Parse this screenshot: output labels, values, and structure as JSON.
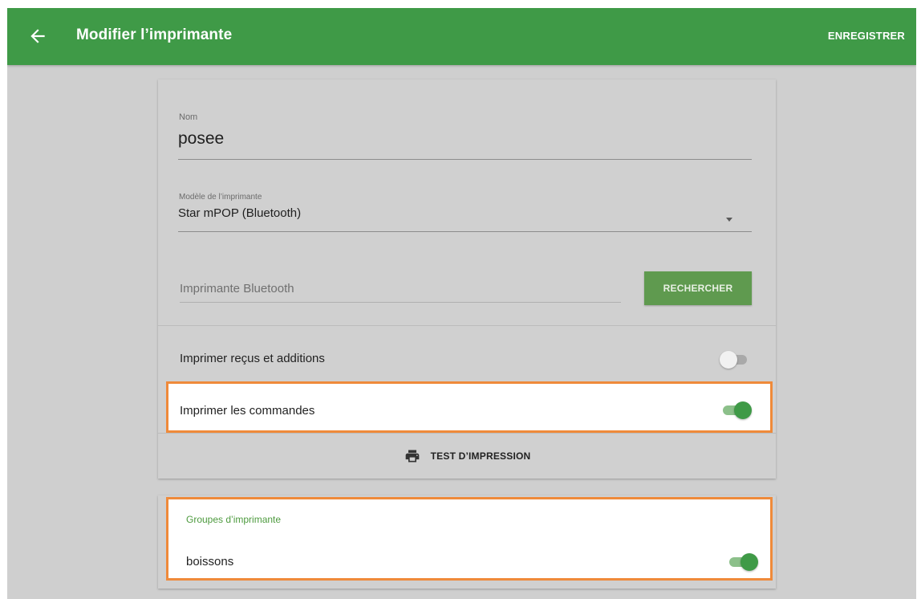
{
  "appbar": {
    "title": "Modifier l’imprimante",
    "save_label": "ENREGISTRER",
    "color": "#3f9a47"
  },
  "form": {
    "name": {
      "label": "Nom",
      "value": "posee"
    },
    "model": {
      "label": "Modèle de l’imprimante",
      "value": "Star mPOP (Bluetooth)"
    },
    "bluetooth": {
      "placeholder": "Imprimante Bluetooth",
      "search_label": "RECHERCHER"
    }
  },
  "toggles": {
    "receipts": {
      "label": "Imprimer reçus et additions",
      "on": false
    },
    "orders": {
      "label": "Imprimer les commandes",
      "on": true
    }
  },
  "test_print": {
    "label": "TEST D’IMPRESSION",
    "icon": "printer-icon"
  },
  "groups": {
    "title": "Groupes d’imprimante",
    "items": [
      {
        "label": "boissons",
        "on": true
      }
    ]
  },
  "colors": {
    "accent": "#3f9a47",
    "highlight": "#ef8a3a",
    "background": "#cfcfcf"
  }
}
